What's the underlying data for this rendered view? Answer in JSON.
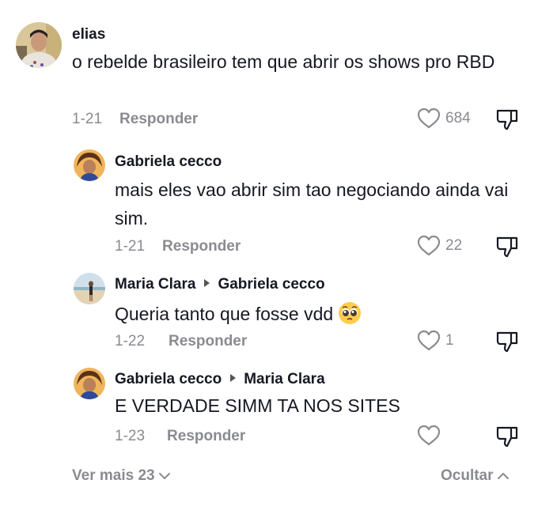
{
  "comments": [
    {
      "username": "elias",
      "text": "o rebelde brasileiro tem que abrir os shows pro RBD",
      "date": "1-21",
      "reply_label": "Responder",
      "likes": "684"
    },
    {
      "username": "Gabriela cecco",
      "text": "mais eles vao abrir sim tao negociando ainda vai sim.",
      "date": "1-21",
      "reply_label": "Responder",
      "likes": "22"
    },
    {
      "username": "Maria Clara",
      "reply_to": "Gabriela cecco",
      "text": "Queria tanto que fosse vdd",
      "emoji": "pleading-face-emoji",
      "date": "1-22",
      "reply_label": "Responder",
      "likes": "1"
    },
    {
      "username": "Gabriela cecco",
      "reply_to": "Maria Clara",
      "text": "E VERDADE SIMM TA NOS SITES",
      "date": "1-23",
      "reply_label": "Responder",
      "likes": ""
    }
  ],
  "footer": {
    "view_more_label": "Ver mais 23",
    "hide_label": "Ocultar"
  },
  "icons": {
    "like": "heart-outline-icon",
    "dislike": "thumbs-down-icon",
    "expand": "chevron-down-icon",
    "collapse": "chevron-up-icon"
  },
  "colors": {
    "text": "#161823",
    "secondary": "#8a8b91",
    "background": "#ffffff"
  }
}
